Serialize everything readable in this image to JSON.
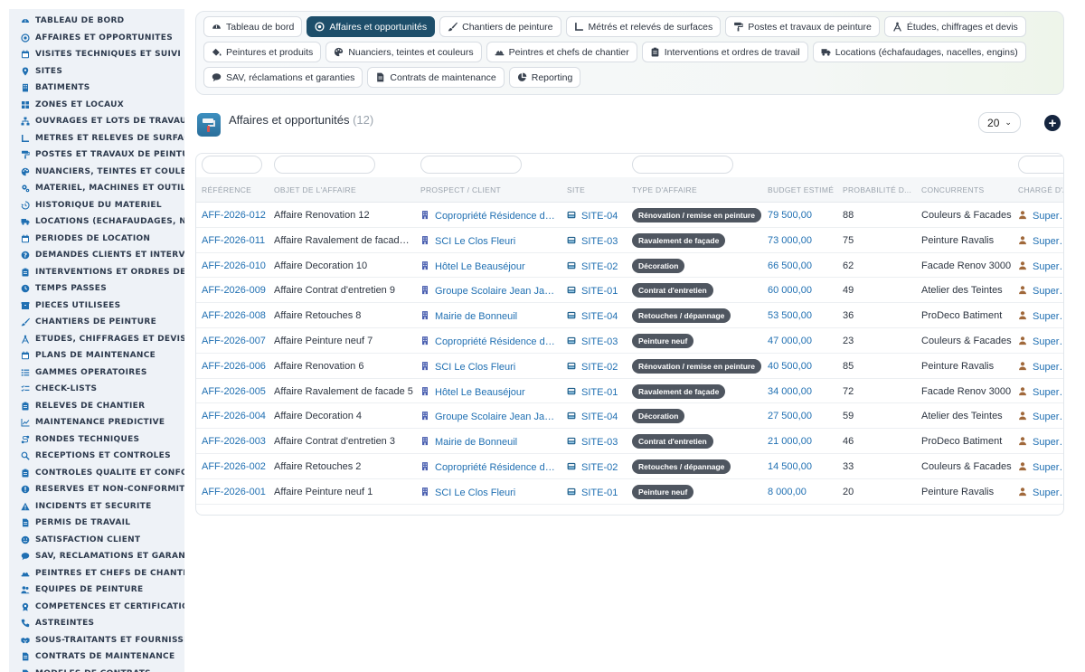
{
  "sidebar": {
    "items": [
      {
        "label": "Tableau de bord",
        "icon": "dashboard-icon"
      },
      {
        "label": "Affaires et opportunités",
        "icon": "target-icon"
      },
      {
        "label": "Visites techniques et suivi",
        "icon": "calendar-icon"
      },
      {
        "label": "Sites",
        "icon": "map-pin-icon"
      },
      {
        "label": "Bâtiments",
        "icon": "building-icon"
      },
      {
        "label": "Zones et locaux",
        "icon": "grid-icon"
      },
      {
        "label": "Ouvrages et lots de travaux",
        "icon": "sitemap-icon"
      },
      {
        "label": "Métrés et relevés de surfaces",
        "icon": "ruler-icon"
      },
      {
        "label": "Postes et travaux de peinture",
        "icon": "paint-roller-icon"
      },
      {
        "label": "Nuanciers, teintes et couleurs",
        "icon": "palette-icon"
      },
      {
        "label": "Matériel, machines et outillage",
        "icon": "cogs-icon"
      },
      {
        "label": "Historique du matériel",
        "icon": "history-icon"
      },
      {
        "label": "Locations (échafaudages, nacelles, engins)",
        "icon": "truck-icon"
      },
      {
        "label": "Périodes de location",
        "icon": "calendar-icon"
      },
      {
        "label": "Demandes clients et interventions",
        "icon": "question-icon"
      },
      {
        "label": "Interventions et ordres de travail",
        "icon": "clipboard-icon"
      },
      {
        "label": "Temps passés",
        "icon": "clock-icon"
      },
      {
        "label": "Pièces utilisées",
        "icon": "box-icon"
      },
      {
        "label": "Chantiers de peinture",
        "icon": "brush-icon"
      },
      {
        "label": "Études, chiffrages et devis",
        "icon": "compass-icon"
      },
      {
        "label": "Plans de maintenance",
        "icon": "calendar-check-icon"
      },
      {
        "label": "Gammes opératoires",
        "icon": "list-icon"
      },
      {
        "label": "Check-lists",
        "icon": "checklist-icon"
      },
      {
        "label": "Relevés de chantier",
        "icon": "clipboard-icon"
      },
      {
        "label": "Maintenance prédictive",
        "icon": "chart-line-icon"
      },
      {
        "label": "Rondes techniques",
        "icon": "route-icon"
      },
      {
        "label": "Réceptions et contrôles",
        "icon": "search-icon"
      },
      {
        "label": "Contrôles qualité et conformité",
        "icon": "clipboard-check-icon"
      },
      {
        "label": "Réserves et non-conformités",
        "icon": "alert-circle-icon"
      },
      {
        "label": "Incidents et sécurité",
        "icon": "warning-icon"
      },
      {
        "label": "Permis de travail",
        "icon": "file-icon"
      },
      {
        "label": "Satisfaction client",
        "icon": "smile-icon"
      },
      {
        "label": "SAV, réclamations et garanties",
        "icon": "comment-icon"
      },
      {
        "label": "Peintres et chefs de chantier",
        "icon": "hard-hat-icon"
      },
      {
        "label": "Équipes de peinture",
        "icon": "users-icon"
      },
      {
        "label": "Compétences et certifications",
        "icon": "certificate-icon"
      },
      {
        "label": "Astreintes",
        "icon": "phone-icon"
      },
      {
        "label": "Sous-traitants et fournisseurs",
        "icon": "handshake-icon"
      },
      {
        "label": "Contrats de maintenance",
        "icon": "file-contract-icon"
      },
      {
        "label": "Modèles de contrats",
        "icon": "file-icon"
      }
    ]
  },
  "tabs": {
    "row1": [
      {
        "label": "Tableau de bord",
        "icon": "dashboard-icon",
        "active": false
      },
      {
        "label": "Affaires et opportunités",
        "icon": "target-icon",
        "active": true
      },
      {
        "label": "Chantiers de peinture",
        "icon": "brush-icon",
        "active": false
      },
      {
        "label": "Métrés et relevés de surfaces",
        "icon": "ruler-icon",
        "active": false
      },
      {
        "label": "Postes et travaux de peinture",
        "icon": "paint-roller-icon",
        "active": false
      },
      {
        "label": "Études, chiffrages et devis",
        "icon": "compass-icon",
        "active": false
      }
    ],
    "row2": [
      {
        "label": "Peintures et produits",
        "icon": "fill-icon",
        "active": false
      },
      {
        "label": "Nuanciers, teintes et couleurs",
        "icon": "palette-icon",
        "active": false
      },
      {
        "label": "Peintres et chefs de chantier",
        "icon": "hard-hat-icon",
        "active": false
      },
      {
        "label": "Interventions et ordres de travail",
        "icon": "clipboard-icon",
        "active": false
      },
      {
        "label": "Locations (échafaudages, nacelles, engins)",
        "icon": "truck-icon",
        "active": false
      }
    ],
    "row3": [
      {
        "label": "SAV, réclamations et garanties",
        "icon": "comment-icon",
        "active": false
      },
      {
        "label": "Contrats de maintenance",
        "icon": "file-contract-icon",
        "active": false
      },
      {
        "label": "Reporting",
        "icon": "pie-chart-icon",
        "active": false
      }
    ]
  },
  "header": {
    "title": "Affaires et opportunités",
    "count": "(12)",
    "page_size": "20",
    "add_label": "+"
  },
  "table": {
    "columns": [
      "Référence",
      "Objet de l'affaire",
      "Prospect / Client",
      "Site",
      "Type d'affaire",
      "Budget estimé",
      "Probabilité d...",
      "Concurrents",
      "Chargé d'a"
    ],
    "rows": [
      {
        "ref": "AFF-2026-012",
        "objet": "Affaire Renovation 12",
        "client": "Copropriété Résidence du Parc",
        "site": "SITE-04",
        "type": "Rénovation / remise en peinture",
        "budget": "79 500,00",
        "proba": "88",
        "concurrents": "Couleurs & Facades",
        "charge": "SuperAdmin"
      },
      {
        "ref": "AFF-2026-011",
        "objet": "Affaire Ravalement de facade 11",
        "client": "SCI Le Clos Fleuri",
        "site": "SITE-03",
        "type": "Ravalement de façade",
        "budget": "73 000,00",
        "proba": "75",
        "concurrents": "Peinture Ravalis",
        "charge": "SuperAdmin"
      },
      {
        "ref": "AFF-2026-010",
        "objet": "Affaire Decoration 10",
        "client": "Hôtel Le Beauséjour",
        "site": "SITE-02",
        "type": "Décoration",
        "budget": "66 500,00",
        "proba": "62",
        "concurrents": "Facade Renov 3000",
        "charge": "SuperAdmin"
      },
      {
        "ref": "AFF-2026-009",
        "objet": "Affaire Contrat d'entretien 9",
        "client": "Groupe Scolaire Jean Jaurès",
        "site": "SITE-01",
        "type": "Contrat d'entretien",
        "budget": "60 000,00",
        "proba": "49",
        "concurrents": "Atelier des Teintes",
        "charge": "SuperAdmin"
      },
      {
        "ref": "AFF-2026-008",
        "objet": "Affaire Retouches 8",
        "client": "Mairie de Bonneuil",
        "site": "SITE-04",
        "type": "Retouches / dépannage",
        "budget": "53 500,00",
        "proba": "36",
        "concurrents": "ProDeco Batiment",
        "charge": "SuperAdmin"
      },
      {
        "ref": "AFF-2026-007",
        "objet": "Affaire Peinture neuf 7",
        "client": "Copropriété Résidence du Parc",
        "site": "SITE-03",
        "type": "Peinture neuf",
        "budget": "47 000,00",
        "proba": "23",
        "concurrents": "Couleurs & Facades",
        "charge": "SuperAdmin"
      },
      {
        "ref": "AFF-2026-006",
        "objet": "Affaire Renovation 6",
        "client": "SCI Le Clos Fleuri",
        "site": "SITE-02",
        "type": "Rénovation / remise en peinture",
        "budget": "40 500,00",
        "proba": "85",
        "concurrents": "Peinture Ravalis",
        "charge": "SuperAdmin"
      },
      {
        "ref": "AFF-2026-005",
        "objet": "Affaire Ravalement de facade 5",
        "client": "Hôtel Le Beauséjour",
        "site": "SITE-01",
        "type": "Ravalement de façade",
        "budget": "34 000,00",
        "proba": "72",
        "concurrents": "Facade Renov 3000",
        "charge": "SuperAdmin"
      },
      {
        "ref": "AFF-2026-004",
        "objet": "Affaire Decoration 4",
        "client": "Groupe Scolaire Jean Jaurès",
        "site": "SITE-04",
        "type": "Décoration",
        "budget": "27 500,00",
        "proba": "59",
        "concurrents": "Atelier des Teintes",
        "charge": "SuperAdmin"
      },
      {
        "ref": "AFF-2026-003",
        "objet": "Affaire Contrat d'entretien 3",
        "client": "Mairie de Bonneuil",
        "site": "SITE-03",
        "type": "Contrat d'entretien",
        "budget": "21 000,00",
        "proba": "46",
        "concurrents": "ProDeco Batiment",
        "charge": "SuperAdmin"
      },
      {
        "ref": "AFF-2026-002",
        "objet": "Affaire Retouches 2",
        "client": "Copropriété Résidence du Parc",
        "site": "SITE-02",
        "type": "Retouches / dépannage",
        "budget": "14 500,00",
        "proba": "33",
        "concurrents": "Couleurs & Facades",
        "charge": "SuperAdmin"
      },
      {
        "ref": "AFF-2026-001",
        "objet": "Affaire Peinture neuf 1",
        "client": "SCI Le Clos Fleuri",
        "site": "SITE-01",
        "type": "Peinture neuf",
        "budget": "8 000,00",
        "proba": "20",
        "concurrents": "Peinture Ravalis",
        "charge": "SuperAdmin"
      }
    ]
  },
  "colors": {
    "accent": "#1d4e6a",
    "link": "#1f6fb2",
    "badge": "#4f5660",
    "sidebar_bg": "#eef2f7",
    "sidebar_icon": "#1f6fb2",
    "user_icon": "#a0683a"
  }
}
